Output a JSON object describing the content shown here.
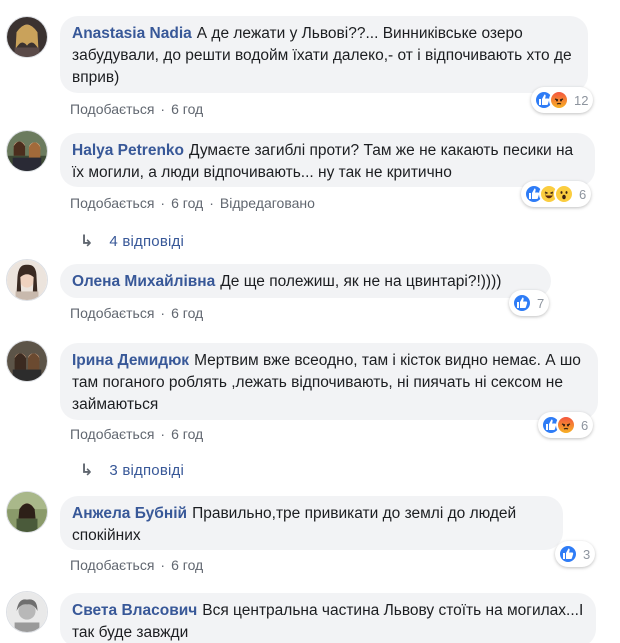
{
  "comments": [
    {
      "author": "Anastasia Nadia",
      "text": "А де лежати у Львові??... Винниківське озеро забудували, до решти водойм їхати далеко,- от і відпочивають хто де вприв)",
      "like_label": "Подобається",
      "time": "6 год",
      "reaction_count": "12",
      "edited": ""
    },
    {
      "author": "Halya Petrenko",
      "text": "Думаєте загиблі проти? Там же не какають песики на їх могили, а люди відпочивають... ну так не критично",
      "like_label": "Подобається",
      "time": "6 год",
      "reaction_count": "6",
      "edited": "Відредаговано",
      "replies": "4 відповіді"
    },
    {
      "author": "Олена Михайлівна",
      "text": "Де ще полежиш, як не на цвинтарі?!)))) ",
      "like_label": "Подобається",
      "time": "6 год",
      "reaction_count": "7",
      "edited": ""
    },
    {
      "author": "Ірина Демидюк",
      "text": "Мертвим вже всеодно, там і кісток видно немає. А шо там поганого роблять ,лежать відпочивають, ні пиячать ні сексом не займаються",
      "like_label": "Подобається",
      "time": "6 год",
      "reaction_count": "6",
      "edited": "",
      "replies": "3 відповіді"
    },
    {
      "author": "Анжела Бубній",
      "text": "Правильно,тре привикати до землі до людей спокійних",
      "like_label": "Подобається",
      "time": "6 год",
      "reaction_count": "3",
      "edited": ""
    },
    {
      "author": "Света Власович",
      "text": "Вся центральна частина Львову стоїть на могилах...І так буде завжди",
      "like_label": "",
      "time": "",
      "reaction_count": "",
      "edited": ""
    }
  ],
  "colors": {
    "author": "#385898",
    "bubble": "#f2f3f5",
    "meta": "#616770",
    "like_reaction": "#2e7cf6",
    "haha_reaction": "#fbcd3f"
  },
  "icons": {
    "reply_arrow": "reply-arrow-icon",
    "like": "like-reaction-icon",
    "angry": "angry-reaction-icon",
    "haha": "haha-reaction-icon",
    "wow": "wow-reaction-icon"
  }
}
